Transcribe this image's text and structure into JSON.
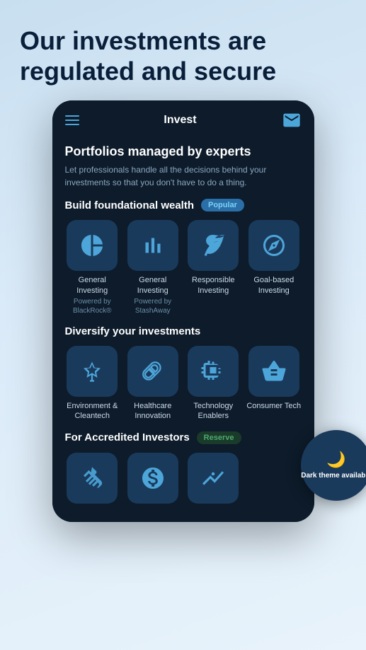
{
  "hero": {
    "title": "Our investments are regulated and secure"
  },
  "phone": {
    "topbar": {
      "title": "Invest"
    },
    "content": {
      "portfolios_header": "Portfolios managed by experts",
      "portfolios_desc": "Let professionals handle all the decisions behind your investments so that you don't have to do a thing.",
      "build_wealth_label": "Build foundational wealth",
      "popular_badge": "Popular",
      "cards_row1": [
        {
          "title": "General Investing",
          "subtitle": "Powered by BlackRock®",
          "icon": "pie"
        },
        {
          "title": "General Investing",
          "subtitle": "Powered by StashAway",
          "icon": "bar"
        },
        {
          "title": "Responsible Investing",
          "subtitle": "",
          "icon": "leaf-chart"
        },
        {
          "title": "Goal-based Investing",
          "subtitle": "",
          "icon": "compass"
        }
      ],
      "diversify_label": "Diversify your investments",
      "cards_row2": [
        {
          "title": "Environment & Cleantech",
          "subtitle": "",
          "icon": "wind"
        },
        {
          "title": "Healthcare Innovation",
          "subtitle": "",
          "icon": "pill"
        },
        {
          "title": "Technology Enablers",
          "subtitle": "",
          "icon": "chip"
        },
        {
          "title": "Consumer Tech",
          "subtitle": "",
          "icon": "basket"
        }
      ],
      "accredited_label": "For Accredited Investors",
      "reserve_badge": "Reserve",
      "cards_row3": [
        {
          "title": "",
          "subtitle": "",
          "icon": "handshake"
        },
        {
          "title": "",
          "subtitle": "",
          "icon": "dollar-circle"
        },
        {
          "title": "",
          "subtitle": "",
          "icon": "chart-up"
        }
      ]
    },
    "dark_theme": {
      "text": "Dark theme available"
    }
  }
}
